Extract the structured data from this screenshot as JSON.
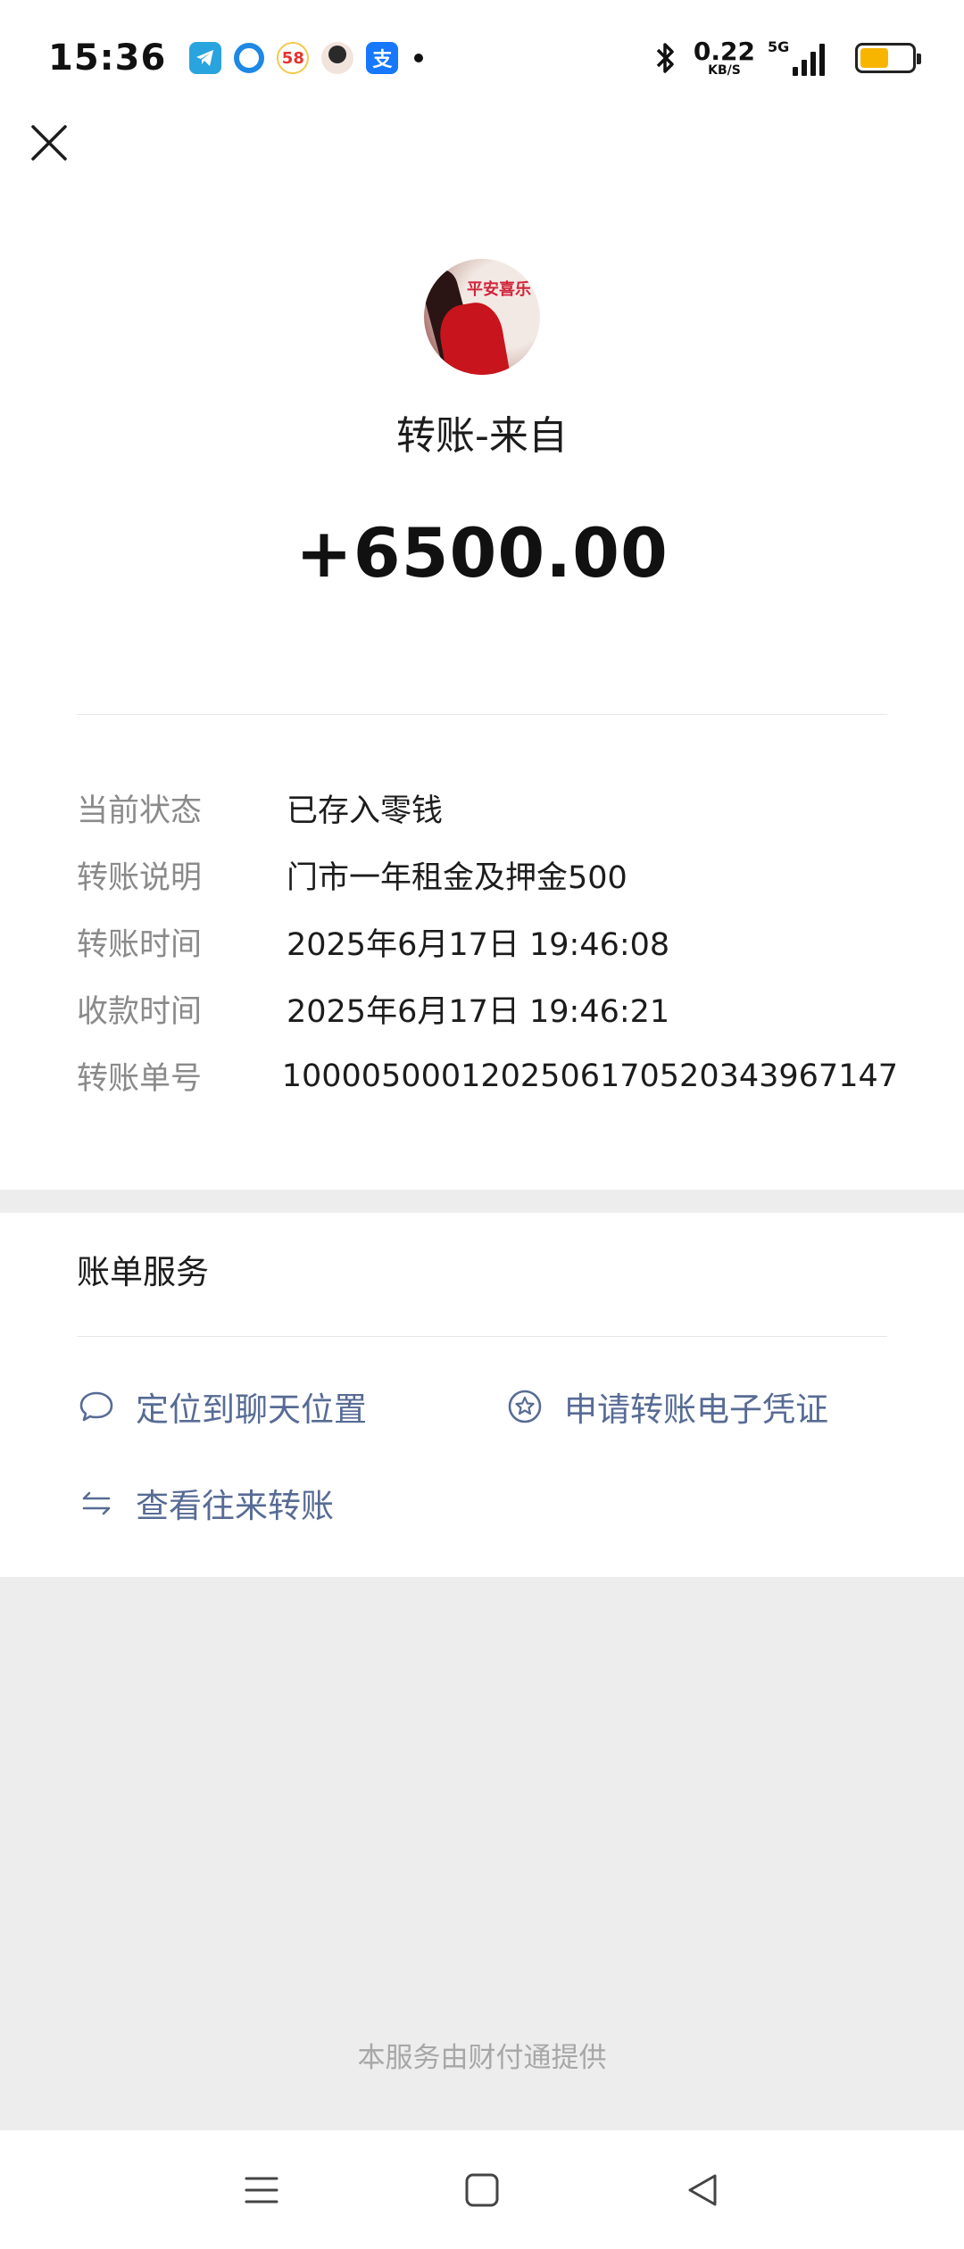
{
  "status_bar": {
    "time": "15:36",
    "net_speed_value": "0.22",
    "net_speed_unit": "KB/S",
    "network_type": "5G",
    "battery_level": 0.55,
    "notification_icons": [
      "telegram-icon",
      "browser-icon",
      "app-58-icon",
      "avatar-app-icon",
      "alipay-icon"
    ],
    "notif_58": "58",
    "notif_alipay": "支"
  },
  "header": {
    "close_icon": "close-icon",
    "avatar_text": "平安喜乐",
    "sender_title": "转账-来自",
    "amount": "+6500.00"
  },
  "details": [
    {
      "label": "当前状态",
      "value": "已存入零钱"
    },
    {
      "label": "转账说明",
      "value": "门市一年租金及押金500"
    },
    {
      "label": "转账时间",
      "value": "2025年6月17日 19:46:08"
    },
    {
      "label": "收款时间",
      "value": "2025年6月17日 19:46:21"
    },
    {
      "label": "转账单号",
      "value": "1000050001202506170520343967147"
    }
  ],
  "services": {
    "title": "账单服务",
    "locate_chat": "定位到聊天位置",
    "apply_voucher": "申请转账电子凭证",
    "view_history": "查看往来转账"
  },
  "footer": {
    "provider_text": "本服务由财付通提供"
  },
  "colors": {
    "link": "#576b95",
    "label_gray": "#8a8a8a",
    "band_gray": "#ededed",
    "battery": "#f7b500"
  }
}
